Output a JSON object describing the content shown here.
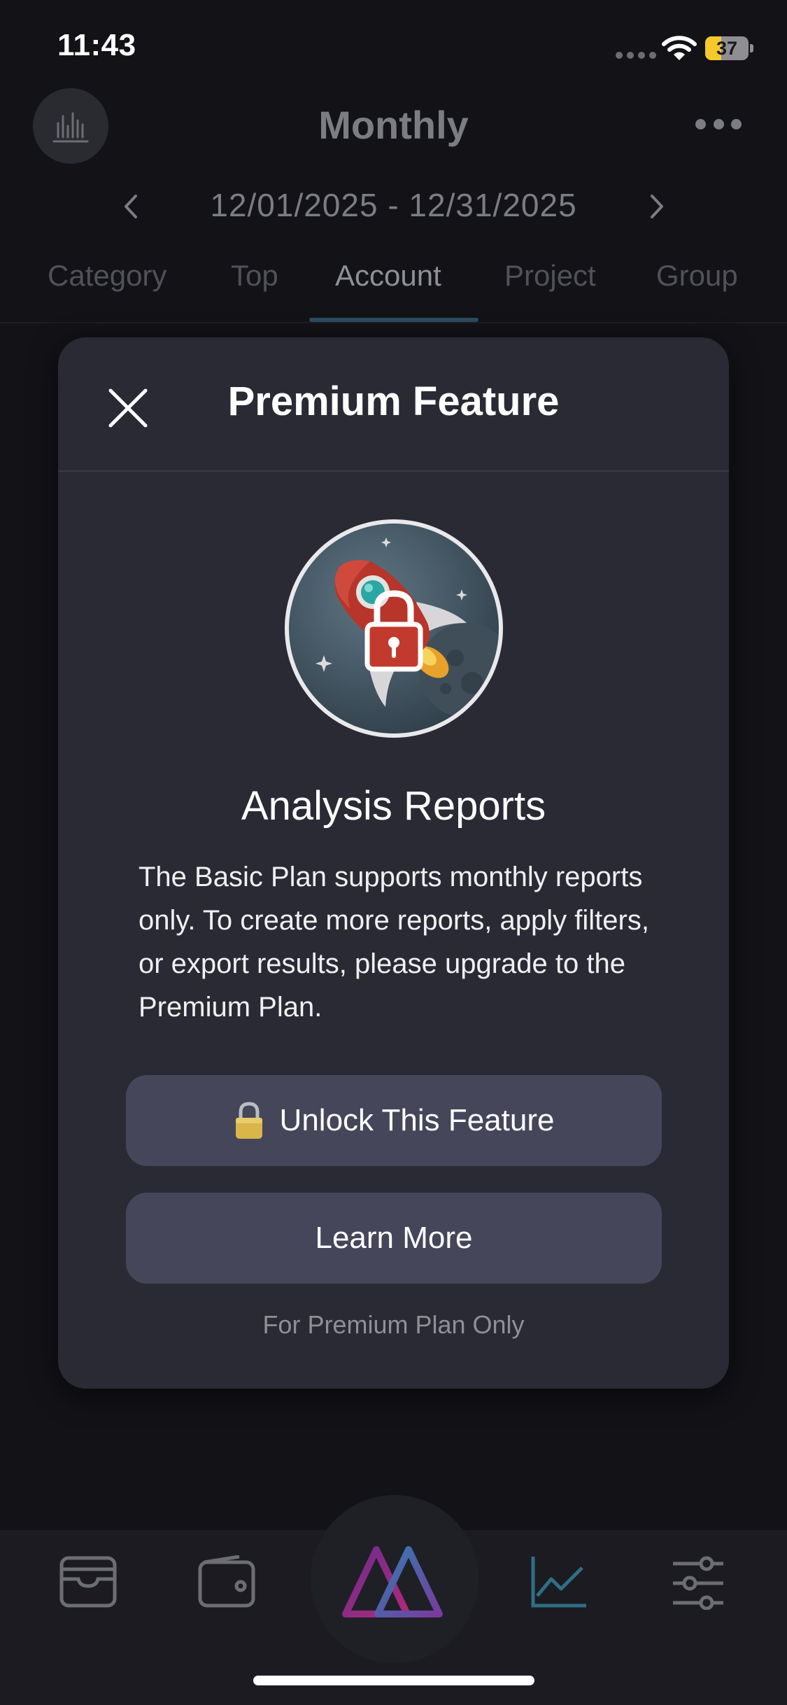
{
  "status_bar": {
    "time": "11:43",
    "battery": "37",
    "battery_level": 0.37
  },
  "header": {
    "title": "Monthly",
    "date_range": "12/01/2025  -  12/31/2025",
    "tabs": [
      {
        "label": "Category",
        "active": false
      },
      {
        "label": "Top",
        "active": false
      },
      {
        "label": "Account",
        "active": true
      },
      {
        "label": "Project",
        "active": false
      },
      {
        "label": "Group",
        "active": false
      }
    ]
  },
  "modal": {
    "title": "Premium Feature",
    "feature_title": "Analysis Reports",
    "description": "The Basic Plan supports monthly reports only. To create more reports, apply filters, or export results, please upgrade to the Premium Plan.",
    "unlock_label": "Unlock This Feature",
    "learn_more_label": "Learn More",
    "footnote": "For Premium Plan Only"
  },
  "tabbar": {
    "items": [
      "wallet-card-icon",
      "wallet-icon",
      "app-logo-icon",
      "chart-icon",
      "settings-sliders-icon"
    ],
    "active": "chart-icon",
    "accent_color": "#2f6f86"
  },
  "colors": {
    "background": "#121217",
    "modal": "#2a2a34",
    "button": "#45465a",
    "battery": "#f5c92b"
  }
}
